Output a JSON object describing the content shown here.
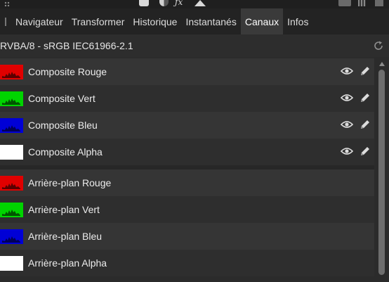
{
  "tabs": [
    {
      "label": "Navigateur",
      "active": false
    },
    {
      "label": "Transformer",
      "active": false
    },
    {
      "label": "Historique",
      "active": false
    },
    {
      "label": "Instantanés",
      "active": false
    },
    {
      "label": "Canaux",
      "active": true
    },
    {
      "label": "Infos",
      "active": false
    }
  ],
  "color_profile": "RVBA/8 - sRGB IEC61966-2.1",
  "channels": [
    {
      "label": "Composite Rouge",
      "thumb": "red",
      "group": "composite",
      "eye_icon": "eye-icon",
      "edit_icon": "pencil-icon"
    },
    {
      "label": "Composite Vert",
      "thumb": "green",
      "group": "composite",
      "eye_icon": "eye-icon",
      "edit_icon": "pencil-icon"
    },
    {
      "label": "Composite Bleu",
      "thumb": "blue",
      "group": "composite",
      "eye_icon": "eye-icon",
      "edit_icon": "pencil-icon"
    },
    {
      "label": "Composite Alpha",
      "thumb": "white",
      "group": "composite",
      "eye_icon": "eye-icon",
      "edit_icon": "pencil-icon"
    },
    {
      "label": "Arrière-plan Rouge",
      "thumb": "red",
      "group": "background"
    },
    {
      "label": "Arrière-plan Vert",
      "thumb": "green",
      "group": "background"
    },
    {
      "label": "Arrière-plan Bleu",
      "thumb": "blue",
      "group": "background"
    },
    {
      "label": "Arrière-plan Alpha",
      "thumb": "white",
      "group": "background"
    }
  ],
  "colors": {
    "panel_bg": "#2b2b2b",
    "tab_active_bg": "#3a3a3a",
    "row_light": "#353535",
    "row_dark": "#2e2e2e",
    "text": "#ececec",
    "icon": "#dcdcdc"
  }
}
